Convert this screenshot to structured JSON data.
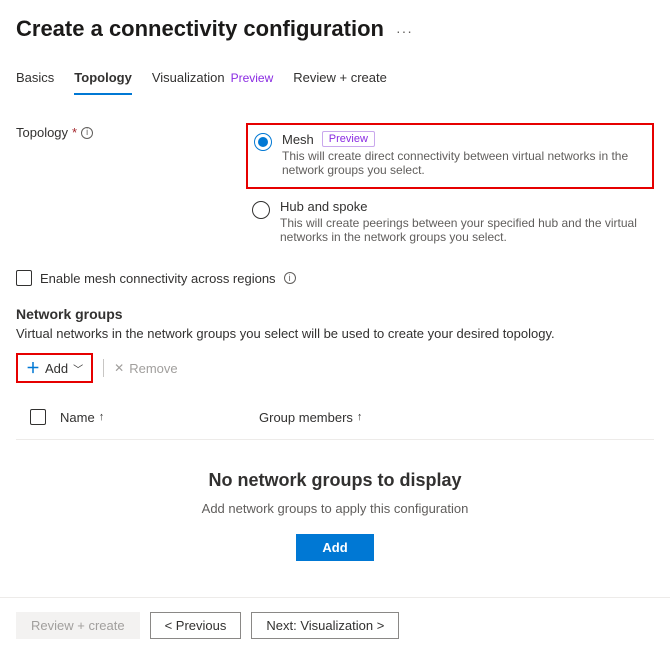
{
  "header": {
    "title": "Create a connectivity configuration",
    "more_icon": "···"
  },
  "tabs": {
    "basics": "Basics",
    "topology": "Topology",
    "visualization": "Visualization",
    "visualization_badge": "Preview",
    "review": "Review + create"
  },
  "topology": {
    "label": "Topology",
    "required": "*",
    "options": {
      "mesh": {
        "title": "Mesh",
        "badge": "Preview",
        "desc": "This will create direct connectivity between virtual networks in the network groups you select."
      },
      "hubspoke": {
        "title": "Hub and spoke",
        "desc": "This will create peerings between your specified hub and the virtual networks in the network groups you select."
      }
    }
  },
  "mesh_checkbox": {
    "label": "Enable mesh connectivity across regions"
  },
  "network_groups": {
    "title": "Network groups",
    "desc": "Virtual networks in the network groups you select will be used to create your desired topology.",
    "add_label": "Add",
    "remove_label": "Remove",
    "columns": {
      "name": "Name",
      "members": "Group members"
    },
    "empty": {
      "title": "No network groups to display",
      "desc": "Add network groups to apply this configuration",
      "add_btn": "Add"
    }
  },
  "footer": {
    "review": "Review + create",
    "previous": "< Previous",
    "next": "Next: Visualization >"
  }
}
